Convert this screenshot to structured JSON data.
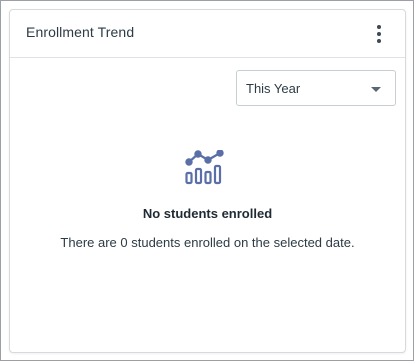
{
  "widget": {
    "title": "Enrollment Trend",
    "menu_icon": "kebab-menu-icon"
  },
  "period_select": {
    "selected": "This Year"
  },
  "empty_state": {
    "icon": "chart-trend-icon",
    "icon_color": "#5a6fa7",
    "title": "No students enrolled",
    "description": "There are 0 students enrolled on the selected date."
  }
}
